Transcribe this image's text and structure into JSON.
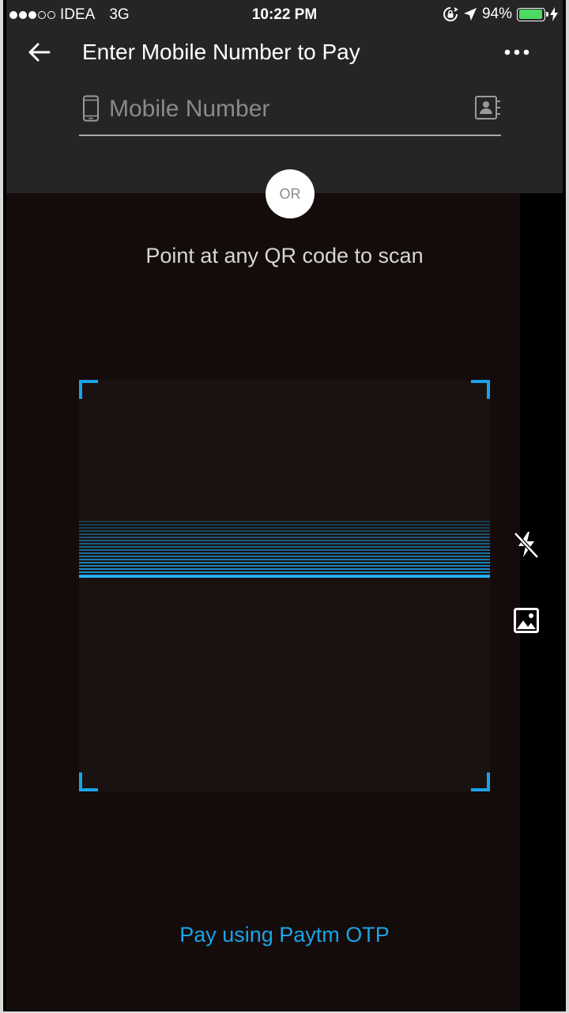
{
  "status_bar": {
    "signal": {
      "filled": 3,
      "empty": 2
    },
    "carrier": "IDEA",
    "network": "3G",
    "time": "10:22 PM",
    "battery_percent_text": "94%",
    "battery_level": 0.94,
    "battery_color": "#4cd964",
    "icons": [
      "orientation-lock-icon",
      "location-arrow-icon",
      "charging-bolt-icon"
    ]
  },
  "header": {
    "back_icon": "back-arrow-icon",
    "title": "Enter Mobile Number to Pay",
    "more_icon": "more-dots-icon"
  },
  "mobile_input": {
    "placeholder": "Mobile Number",
    "value": "",
    "leading_icon": "phone-icon",
    "trailing_icon": "contacts-book-icon"
  },
  "divider": {
    "or_label": "OR"
  },
  "scanner": {
    "hint": "Point at any QR code to scan",
    "accent_color": "#1aa3e8",
    "flash_icon": "flash-off-icon",
    "gallery_icon": "gallery-image-icon"
  },
  "footer": {
    "otp_link": "Pay using Paytm OTP"
  }
}
